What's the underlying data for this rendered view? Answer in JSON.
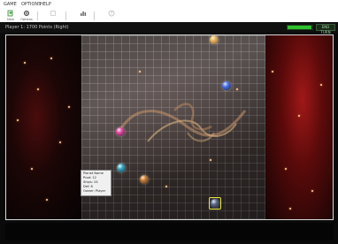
{
  "menu": {
    "items": [
      "GAME",
      "OPTIONS",
      "HELP"
    ]
  },
  "toolbar": {
    "buttons": [
      {
        "name": "new-game",
        "icon": "new-icon",
        "label": "New"
      },
      {
        "name": "settings",
        "icon": "gear-icon",
        "label": "Options"
      },
      {
        "name": "disabled-1",
        "icon": "blank-icon",
        "label": ""
      },
      {
        "name": "stats",
        "icon": "stats-icon",
        "label": ""
      },
      {
        "name": "help",
        "icon": "help-icon",
        "label": ""
      }
    ]
  },
  "status": {
    "text": "Player 1: 1700 Points (Right)",
    "progress": 0.95,
    "action_label": "END TURN"
  },
  "info": {
    "lines": [
      "Planet Name",
      "Prod: 12",
      "Ships: 24",
      "Def: 8",
      "Owner: Player"
    ]
  },
  "colors": {
    "accent": "#2ec02e",
    "selection": "#e8e840",
    "nebula_red": "#a01818"
  }
}
